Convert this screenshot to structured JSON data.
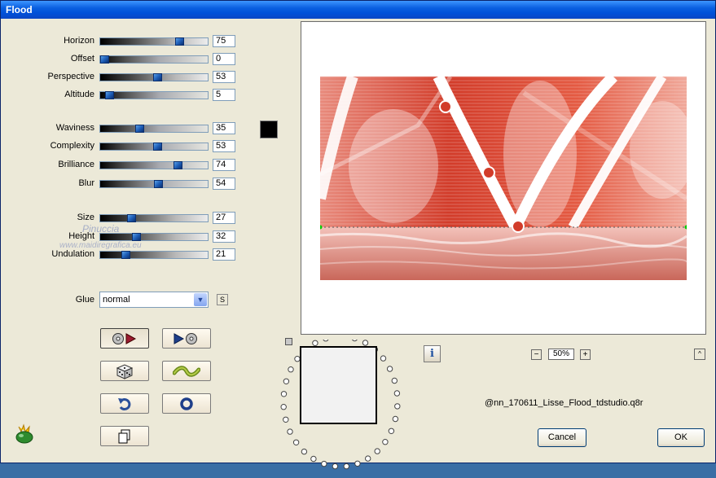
{
  "window": {
    "title": "Flood"
  },
  "groups": [
    {
      "sliders": [
        {
          "label": "Horizon",
          "value": "75",
          "fraction": 0.75,
          "track": "dark"
        },
        {
          "label": "Offset",
          "value": "0",
          "fraction": 0.0,
          "track": "gray"
        },
        {
          "label": "Perspective",
          "value": "53",
          "fraction": 0.53,
          "track": "dark"
        },
        {
          "label": "Altitude",
          "value": "5",
          "fraction": 0.05,
          "track": "gray"
        }
      ]
    },
    {
      "sliders": [
        {
          "label": "Waviness",
          "value": "35",
          "fraction": 0.35,
          "track": "gray"
        },
        {
          "label": "Complexity",
          "value": "53",
          "fraction": 0.53,
          "track": "gray"
        },
        {
          "label": "Brilliance",
          "value": "74",
          "fraction": 0.74,
          "track": "gray"
        },
        {
          "label": "Blur",
          "value": "54",
          "fraction": 0.54,
          "track": "gray"
        }
      ]
    },
    {
      "sliders": [
        {
          "label": "Size",
          "value": "27",
          "fraction": 0.27,
          "track": "dark"
        },
        {
          "label": "Height",
          "value": "32",
          "fraction": 0.32,
          "track": "dark"
        },
        {
          "label": "Undulation",
          "value": "21",
          "fraction": 0.21,
          "track": "dark"
        }
      ]
    }
  ],
  "color_swatch": "#000000",
  "glue": {
    "label": "Glue",
    "selected": "normal",
    "s_button": "S"
  },
  "watermark": {
    "line1": "Pinuccia",
    "line2": "www.maidiregrafica.eu"
  },
  "preview": {
    "zoom": "50%",
    "zoom_minus": "−",
    "zoom_plus": "+",
    "up": "^"
  },
  "info_button": "i",
  "filename": "@nn_170611_Lisse_Flood_tdstudio.q8r",
  "buttons": {
    "cancel": "Cancel",
    "ok": "OK"
  },
  "colors": {
    "title_bar": "#0a5fe0",
    "dialog_bg": "#ece9d8",
    "preview_red": "#d94a37"
  }
}
